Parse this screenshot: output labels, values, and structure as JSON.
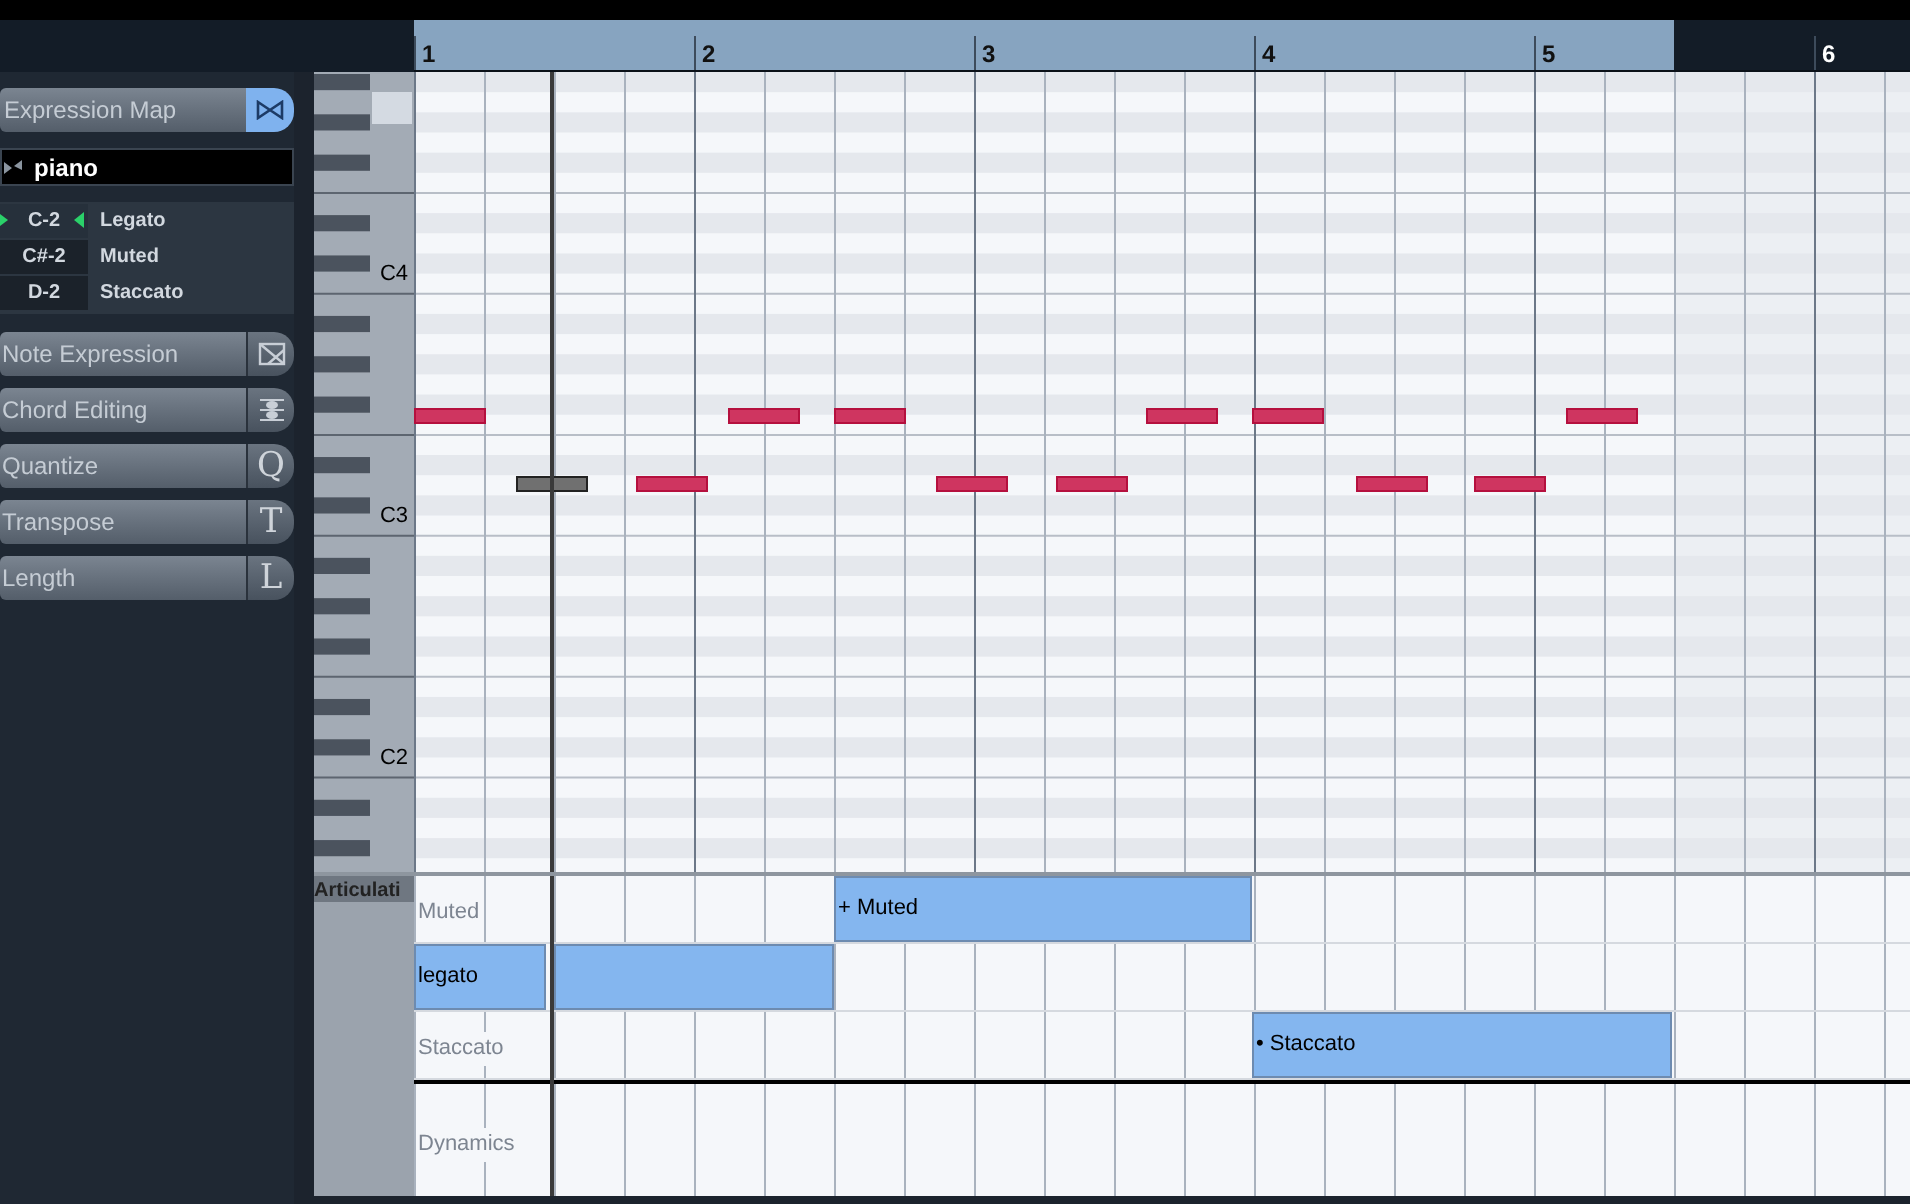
{
  "inspector": {
    "expression_map": {
      "title": "Expression Map",
      "preset": "piano",
      "articulations": [
        {
          "note": "C-2",
          "name": "Legato",
          "selected": true
        },
        {
          "note": "C#-2",
          "name": "Muted",
          "selected": false
        },
        {
          "note": "D-2",
          "name": "Staccato",
          "selected": false
        }
      ]
    },
    "sections": [
      {
        "label": "Note Expression",
        "kind": "note-expression"
      },
      {
        "label": "Chord Editing",
        "kind": "chord"
      },
      {
        "label": "Quantize",
        "kind": "letter",
        "key": "Q"
      },
      {
        "label": "Transpose",
        "kind": "letter",
        "key": "T"
      },
      {
        "label": "Length",
        "kind": "letter",
        "key": "L"
      }
    ]
  },
  "ruler": {
    "bars": [
      "1",
      "2",
      "3",
      "4",
      "5",
      "6"
    ]
  },
  "keyboard": {
    "labels": [
      "C4",
      "C3",
      "C2"
    ]
  },
  "notes": [
    {
      "muted": false
    },
    {
      "muted": false
    },
    {
      "muted": false
    },
    {
      "muted": false
    },
    {
      "muted": false
    },
    {
      "muted": false
    },
    {
      "muted": true
    },
    {
      "muted": false
    },
    {
      "muted": false
    },
    {
      "muted": false
    },
    {
      "muted": false
    },
    {
      "muted": false
    }
  ],
  "articulation_lane": {
    "header": "Articulati",
    "rows": [
      {
        "label": "Muted",
        "blocks": [
          {
            "kind": "labeled",
            "text": "+ Muted"
          }
        ]
      },
      {
        "blocks": [
          {
            "kind": "labeled",
            "text": "legato"
          },
          {
            "kind": "plain"
          }
        ]
      },
      {
        "label": "Staccato",
        "blocks": [
          {
            "kind": "labeled",
            "text": "• Staccato"
          }
        ]
      }
    ],
    "dynamics_label": "Dynamics"
  }
}
